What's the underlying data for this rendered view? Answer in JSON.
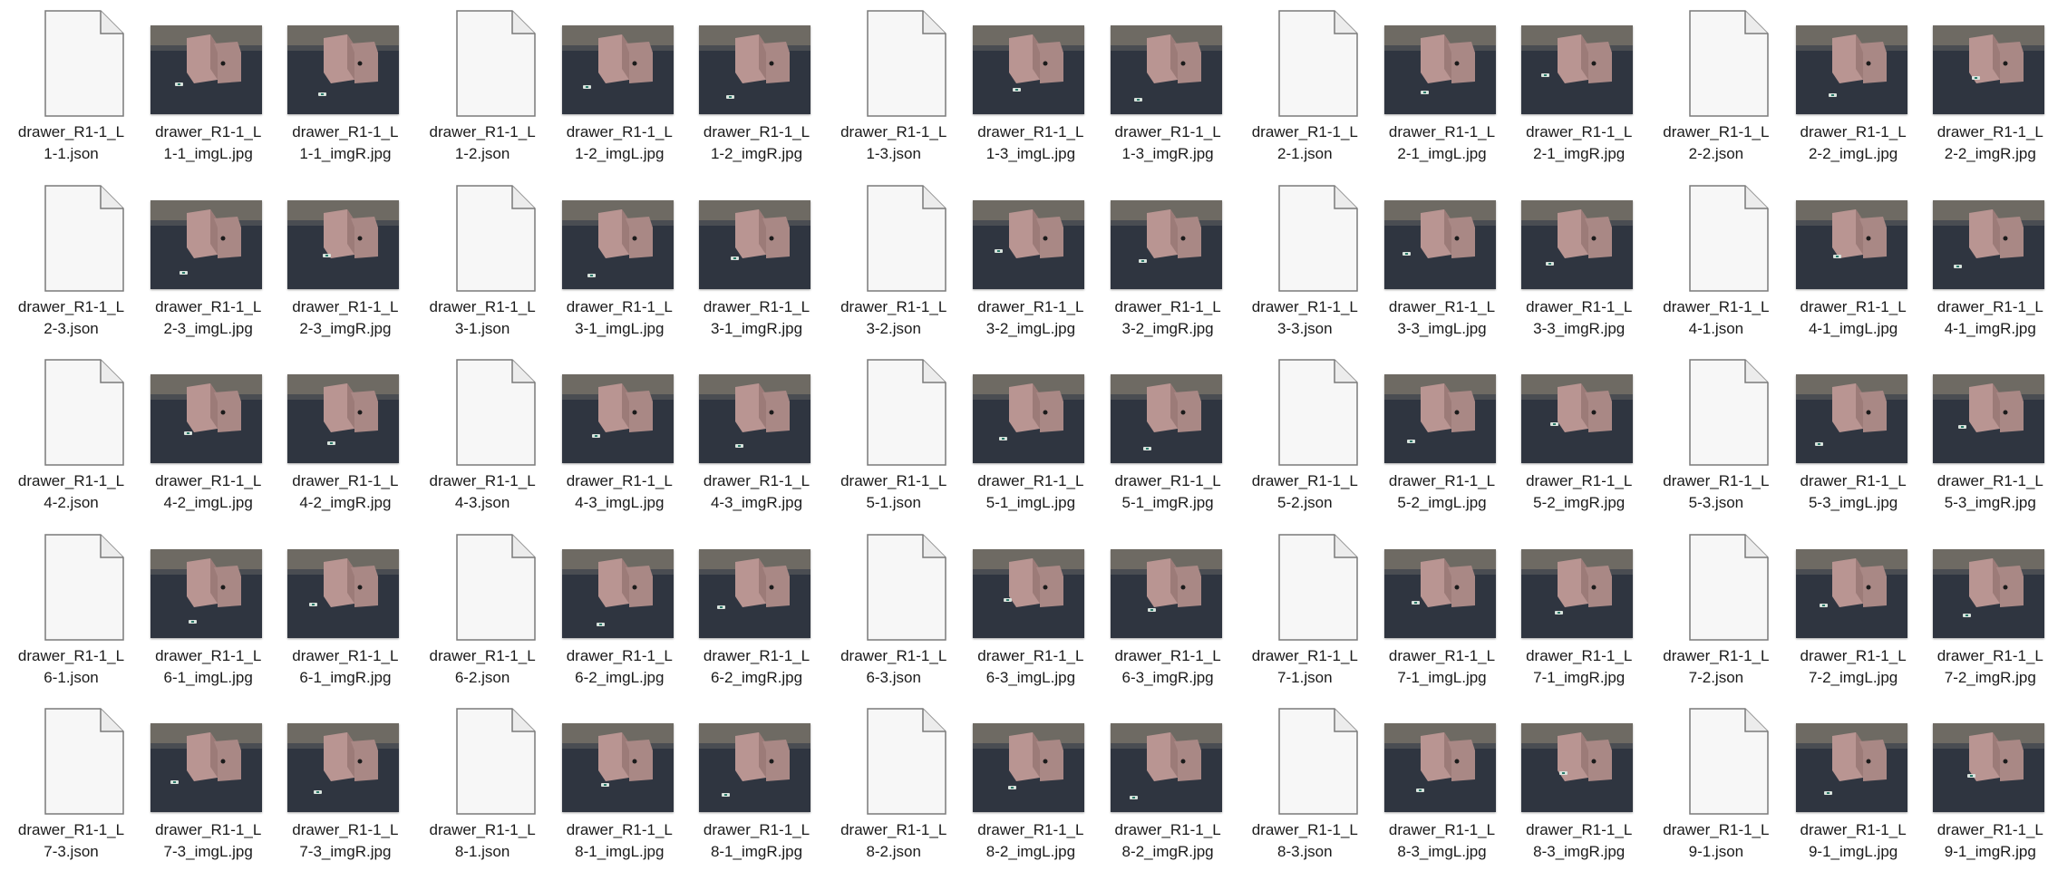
{
  "file_list": {
    "files": [
      {
        "name": "drawer_R1-1_L1-1.json",
        "line1": "drawer_R1-1_L",
        "line2": "1-1.json",
        "kind": "json",
        "icon": "blank-document-icon"
      },
      {
        "name": "drawer_R1-1_L1-1_imgL.jpg",
        "line1": "drawer_R1-1_L",
        "line2": "1-1_imgL.jpg",
        "kind": "image",
        "icon": "image-thumbnail"
      },
      {
        "name": "drawer_R1-1_L1-1_imgR.jpg",
        "line1": "drawer_R1-1_L",
        "line2": "1-1_imgR.jpg",
        "kind": "image",
        "icon": "image-thumbnail"
      },
      {
        "name": "drawer_R1-1_L1-2.json",
        "line1": "drawer_R1-1_L",
        "line2": "1-2.json",
        "kind": "json",
        "icon": "blank-document-icon"
      },
      {
        "name": "drawer_R1-1_L1-2_imgL.jpg",
        "line1": "drawer_R1-1_L",
        "line2": "1-2_imgL.jpg",
        "kind": "image",
        "icon": "image-thumbnail"
      },
      {
        "name": "drawer_R1-1_L1-2_imgR.jpg",
        "line1": "drawer_R1-1_L",
        "line2": "1-2_imgR.jpg",
        "kind": "image",
        "icon": "image-thumbnail"
      },
      {
        "name": "drawer_R1-1_L1-3.json",
        "line1": "drawer_R1-1_L",
        "line2": "1-3.json",
        "kind": "json",
        "icon": "blank-document-icon"
      },
      {
        "name": "drawer_R1-1_L1-3_imgL.jpg",
        "line1": "drawer_R1-1_L",
        "line2": "1-3_imgL.jpg",
        "kind": "image",
        "icon": "image-thumbnail"
      },
      {
        "name": "drawer_R1-1_L1-3_imgR.jpg",
        "line1": "drawer_R1-1_L",
        "line2": "1-3_imgR.jpg",
        "kind": "image",
        "icon": "image-thumbnail"
      },
      {
        "name": "drawer_R1-1_L2-1.json",
        "line1": "drawer_R1-1_L",
        "line2": "2-1.json",
        "kind": "json",
        "icon": "blank-document-icon"
      },
      {
        "name": "drawer_R1-1_L2-1_imgL.jpg",
        "line1": "drawer_R1-1_L",
        "line2": "2-1_imgL.jpg",
        "kind": "image",
        "icon": "image-thumbnail"
      },
      {
        "name": "drawer_R1-1_L2-1_imgR.jpg",
        "line1": "drawer_R1-1_L",
        "line2": "2-1_imgR.jpg",
        "kind": "image",
        "icon": "image-thumbnail"
      },
      {
        "name": "drawer_R1-1_L2-2.json",
        "line1": "drawer_R1-1_L",
        "line2": "2-2.json",
        "kind": "json",
        "icon": "blank-document-icon"
      },
      {
        "name": "drawer_R1-1_L2-2_imgL.jpg",
        "line1": "drawer_R1-1_L",
        "line2": "2-2_imgL.jpg",
        "kind": "image",
        "icon": "image-thumbnail"
      },
      {
        "name": "drawer_R1-1_L2-2_imgR.jpg",
        "line1": "drawer_R1-1_L",
        "line2": "2-2_imgR.jpg",
        "kind": "image",
        "icon": "image-thumbnail"
      },
      {
        "name": "drawer_R1-1_L2-3.json",
        "line1": "drawer_R1-1_L",
        "line2": "2-3.json",
        "kind": "json",
        "icon": "blank-document-icon"
      },
      {
        "name": "drawer_R1-1_L2-3_imgL.jpg",
        "line1": "drawer_R1-1_L",
        "line2": "2-3_imgL.jpg",
        "kind": "image",
        "icon": "image-thumbnail"
      },
      {
        "name": "drawer_R1-1_L2-3_imgR.jpg",
        "line1": "drawer_R1-1_L",
        "line2": "2-3_imgR.jpg",
        "kind": "image",
        "icon": "image-thumbnail"
      },
      {
        "name": "drawer_R1-1_L3-1.json",
        "line1": "drawer_R1-1_L",
        "line2": "3-1.json",
        "kind": "json",
        "icon": "blank-document-icon"
      },
      {
        "name": "drawer_R1-1_L3-1_imgL.jpg",
        "line1": "drawer_R1-1_L",
        "line2": "3-1_imgL.jpg",
        "kind": "image",
        "icon": "image-thumbnail"
      },
      {
        "name": "drawer_R1-1_L3-1_imgR.jpg",
        "line1": "drawer_R1-1_L",
        "line2": "3-1_imgR.jpg",
        "kind": "image",
        "icon": "image-thumbnail"
      },
      {
        "name": "drawer_R1-1_L3-2.json",
        "line1": "drawer_R1-1_L",
        "line2": "3-2.json",
        "kind": "json",
        "icon": "blank-document-icon"
      },
      {
        "name": "drawer_R1-1_L3-2_imgL.jpg",
        "line1": "drawer_R1-1_L",
        "line2": "3-2_imgL.jpg",
        "kind": "image",
        "icon": "image-thumbnail"
      },
      {
        "name": "drawer_R1-1_L3-2_imgR.jpg",
        "line1": "drawer_R1-1_L",
        "line2": "3-2_imgR.jpg",
        "kind": "image",
        "icon": "image-thumbnail"
      },
      {
        "name": "drawer_R1-1_L3-3.json",
        "line1": "drawer_R1-1_L",
        "line2": "3-3.json",
        "kind": "json",
        "icon": "blank-document-icon"
      },
      {
        "name": "drawer_R1-1_L3-3_imgL.jpg",
        "line1": "drawer_R1-1_L",
        "line2": "3-3_imgL.jpg",
        "kind": "image",
        "icon": "image-thumbnail"
      },
      {
        "name": "drawer_R1-1_L3-3_imgR.jpg",
        "line1": "drawer_R1-1_L",
        "line2": "3-3_imgR.jpg",
        "kind": "image",
        "icon": "image-thumbnail"
      },
      {
        "name": "drawer_R1-1_L4-1.json",
        "line1": "drawer_R1-1_L",
        "line2": "4-1.json",
        "kind": "json",
        "icon": "blank-document-icon"
      },
      {
        "name": "drawer_R1-1_L4-1_imgL.jpg",
        "line1": "drawer_R1-1_L",
        "line2": "4-1_imgL.jpg",
        "kind": "image",
        "icon": "image-thumbnail"
      },
      {
        "name": "drawer_R1-1_L4-1_imgR.jpg",
        "line1": "drawer_R1-1_L",
        "line2": "4-1_imgR.jpg",
        "kind": "image",
        "icon": "image-thumbnail"
      },
      {
        "name": "drawer_R1-1_L4-2.json",
        "line1": "drawer_R1-1_L",
        "line2": "4-2.json",
        "kind": "json",
        "icon": "blank-document-icon"
      },
      {
        "name": "drawer_R1-1_L4-2_imgL.jpg",
        "line1": "drawer_R1-1_L",
        "line2": "4-2_imgL.jpg",
        "kind": "image",
        "icon": "image-thumbnail"
      },
      {
        "name": "drawer_R1-1_L4-2_imgR.jpg",
        "line1": "drawer_R1-1_L",
        "line2": "4-2_imgR.jpg",
        "kind": "image",
        "icon": "image-thumbnail"
      },
      {
        "name": "drawer_R1-1_L4-3.json",
        "line1": "drawer_R1-1_L",
        "line2": "4-3.json",
        "kind": "json",
        "icon": "blank-document-icon"
      },
      {
        "name": "drawer_R1-1_L4-3_imgL.jpg",
        "line1": "drawer_R1-1_L",
        "line2": "4-3_imgL.jpg",
        "kind": "image",
        "icon": "image-thumbnail"
      },
      {
        "name": "drawer_R1-1_L4-3_imgR.jpg",
        "line1": "drawer_R1-1_L",
        "line2": "4-3_imgR.jpg",
        "kind": "image",
        "icon": "image-thumbnail"
      },
      {
        "name": "drawer_R1-1_L5-1.json",
        "line1": "drawer_R1-1_L",
        "line2": "5-1.json",
        "kind": "json",
        "icon": "blank-document-icon"
      },
      {
        "name": "drawer_R1-1_L5-1_imgL.jpg",
        "line1": "drawer_R1-1_L",
        "line2": "5-1_imgL.jpg",
        "kind": "image",
        "icon": "image-thumbnail"
      },
      {
        "name": "drawer_R1-1_L5-1_imgR.jpg",
        "line1": "drawer_R1-1_L",
        "line2": "5-1_imgR.jpg",
        "kind": "image",
        "icon": "image-thumbnail"
      },
      {
        "name": "drawer_R1-1_L5-2.json",
        "line1": "drawer_R1-1_L",
        "line2": "5-2.json",
        "kind": "json",
        "icon": "blank-document-icon"
      },
      {
        "name": "drawer_R1-1_L5-2_imgL.jpg",
        "line1": "drawer_R1-1_L",
        "line2": "5-2_imgL.jpg",
        "kind": "image",
        "icon": "image-thumbnail"
      },
      {
        "name": "drawer_R1-1_L5-2_imgR.jpg",
        "line1": "drawer_R1-1_L",
        "line2": "5-2_imgR.jpg",
        "kind": "image",
        "icon": "image-thumbnail"
      },
      {
        "name": "drawer_R1-1_L5-3.json",
        "line1": "drawer_R1-1_L",
        "line2": "5-3.json",
        "kind": "json",
        "icon": "blank-document-icon"
      },
      {
        "name": "drawer_R1-1_L5-3_imgL.jpg",
        "line1": "drawer_R1-1_L",
        "line2": "5-3_imgL.jpg",
        "kind": "image",
        "icon": "image-thumbnail"
      },
      {
        "name": "drawer_R1-1_L5-3_imgR.jpg",
        "line1": "drawer_R1-1_L",
        "line2": "5-3_imgR.jpg",
        "kind": "image",
        "icon": "image-thumbnail"
      },
      {
        "name": "drawer_R1-1_L6-1.json",
        "line1": "drawer_R1-1_L",
        "line2": "6-1.json",
        "kind": "json",
        "icon": "blank-document-icon"
      },
      {
        "name": "drawer_R1-1_L6-1_imgL.jpg",
        "line1": "drawer_R1-1_L",
        "line2": "6-1_imgL.jpg",
        "kind": "image",
        "icon": "image-thumbnail"
      },
      {
        "name": "drawer_R1-1_L6-1_imgR.jpg",
        "line1": "drawer_R1-1_L",
        "line2": "6-1_imgR.jpg",
        "kind": "image",
        "icon": "image-thumbnail"
      },
      {
        "name": "drawer_R1-1_L6-2.json",
        "line1": "drawer_R1-1_L",
        "line2": "6-2.json",
        "kind": "json",
        "icon": "blank-document-icon"
      },
      {
        "name": "drawer_R1-1_L6-2_imgL.jpg",
        "line1": "drawer_R1-1_L",
        "line2": "6-2_imgL.jpg",
        "kind": "image",
        "icon": "image-thumbnail"
      },
      {
        "name": "drawer_R1-1_L6-2_imgR.jpg",
        "line1": "drawer_R1-1_L",
        "line2": "6-2_imgR.jpg",
        "kind": "image",
        "icon": "image-thumbnail"
      },
      {
        "name": "drawer_R1-1_L6-3.json",
        "line1": "drawer_R1-1_L",
        "line2": "6-3.json",
        "kind": "json",
        "icon": "blank-document-icon"
      },
      {
        "name": "drawer_R1-1_L6-3_imgL.jpg",
        "line1": "drawer_R1-1_L",
        "line2": "6-3_imgL.jpg",
        "kind": "image",
        "icon": "image-thumbnail"
      },
      {
        "name": "drawer_R1-1_L6-3_imgR.jpg",
        "line1": "drawer_R1-1_L",
        "line2": "6-3_imgR.jpg",
        "kind": "image",
        "icon": "image-thumbnail"
      },
      {
        "name": "drawer_R1-1_L7-1.json",
        "line1": "drawer_R1-1_L",
        "line2": "7-1.json",
        "kind": "json",
        "icon": "blank-document-icon"
      },
      {
        "name": "drawer_R1-1_L7-1_imgL.jpg",
        "line1": "drawer_R1-1_L",
        "line2": "7-1_imgL.jpg",
        "kind": "image",
        "icon": "image-thumbnail"
      },
      {
        "name": "drawer_R1-1_L7-1_imgR.jpg",
        "line1": "drawer_R1-1_L",
        "line2": "7-1_imgR.jpg",
        "kind": "image",
        "icon": "image-thumbnail"
      },
      {
        "name": "drawer_R1-1_L7-2.json",
        "line1": "drawer_R1-1_L",
        "line2": "7-2.json",
        "kind": "json",
        "icon": "blank-document-icon"
      },
      {
        "name": "drawer_R1-1_L7-2_imgL.jpg",
        "line1": "drawer_R1-1_L",
        "line2": "7-2_imgL.jpg",
        "kind": "image",
        "icon": "image-thumbnail"
      },
      {
        "name": "drawer_R1-1_L7-2_imgR.jpg",
        "line1": "drawer_R1-1_L",
        "line2": "7-2_imgR.jpg",
        "kind": "image",
        "icon": "image-thumbnail"
      },
      {
        "name": "drawer_R1-1_L7-3.json",
        "line1": "drawer_R1-1_L",
        "line2": "7-3.json",
        "kind": "json",
        "icon": "blank-document-icon"
      },
      {
        "name": "drawer_R1-1_L7-3_imgL.jpg",
        "line1": "drawer_R1-1_L",
        "line2": "7-3_imgL.jpg",
        "kind": "image",
        "icon": "image-thumbnail"
      },
      {
        "name": "drawer_R1-1_L7-3_imgR.jpg",
        "line1": "drawer_R1-1_L",
        "line2": "7-3_imgR.jpg",
        "kind": "image",
        "icon": "image-thumbnail"
      },
      {
        "name": "drawer_R1-1_L8-1.json",
        "line1": "drawer_R1-1_L",
        "line2": "8-1.json",
        "kind": "json",
        "icon": "blank-document-icon"
      },
      {
        "name": "drawer_R1-1_L8-1_imgL.jpg",
        "line1": "drawer_R1-1_L",
        "line2": "8-1_imgL.jpg",
        "kind": "image",
        "icon": "image-thumbnail"
      },
      {
        "name": "drawer_R1-1_L8-1_imgR.jpg",
        "line1": "drawer_R1-1_L",
        "line2": "8-1_imgR.jpg",
        "kind": "image",
        "icon": "image-thumbnail"
      },
      {
        "name": "drawer_R1-1_L8-2.json",
        "line1": "drawer_R1-1_L",
        "line2": "8-2.json",
        "kind": "json",
        "icon": "blank-document-icon"
      },
      {
        "name": "drawer_R1-1_L8-2_imgL.jpg",
        "line1": "drawer_R1-1_L",
        "line2": "8-2_imgL.jpg",
        "kind": "image",
        "icon": "image-thumbnail"
      },
      {
        "name": "drawer_R1-1_L8-2_imgR.jpg",
        "line1": "drawer_R1-1_L",
        "line2": "8-2_imgR.jpg",
        "kind": "image",
        "icon": "image-thumbnail"
      },
      {
        "name": "drawer_R1-1_L8-3.json",
        "line1": "drawer_R1-1_L",
        "line2": "8-3.json",
        "kind": "json",
        "icon": "blank-document-icon"
      },
      {
        "name": "drawer_R1-1_L8-3_imgL.jpg",
        "line1": "drawer_R1-1_L",
        "line2": "8-3_imgL.jpg",
        "kind": "image",
        "icon": "image-thumbnail"
      },
      {
        "name": "drawer_R1-1_L8-3_imgR.jpg",
        "line1": "drawer_R1-1_L",
        "line2": "8-3_imgR.jpg",
        "kind": "image",
        "icon": "image-thumbnail"
      },
      {
        "name": "drawer_R1-1_L9-1.json",
        "line1": "drawer_R1-1_L",
        "line2": "9-1.json",
        "kind": "json",
        "icon": "blank-document-icon"
      },
      {
        "name": "drawer_R1-1_L9-1_imgL.jpg",
        "line1": "drawer_R1-1_L",
        "line2": "9-1_imgL.jpg",
        "kind": "image",
        "icon": "image-thumbnail"
      },
      {
        "name": "drawer_R1-1_L9-1_imgR.jpg",
        "line1": "drawer_R1-1_L",
        "line2": "9-1_imgR.jpg",
        "kind": "image",
        "icon": "image-thumbnail"
      }
    ]
  },
  "colors": {
    "background": "#ffffff",
    "label_text": "#1a1a1a",
    "doc_icon_fill": "#f7f7f7",
    "doc_icon_stroke": "#7a7a7a",
    "thumb_floor": "#2f3540",
    "thumb_wall": "#6e6a63",
    "thumb_box": "#b99592"
  }
}
